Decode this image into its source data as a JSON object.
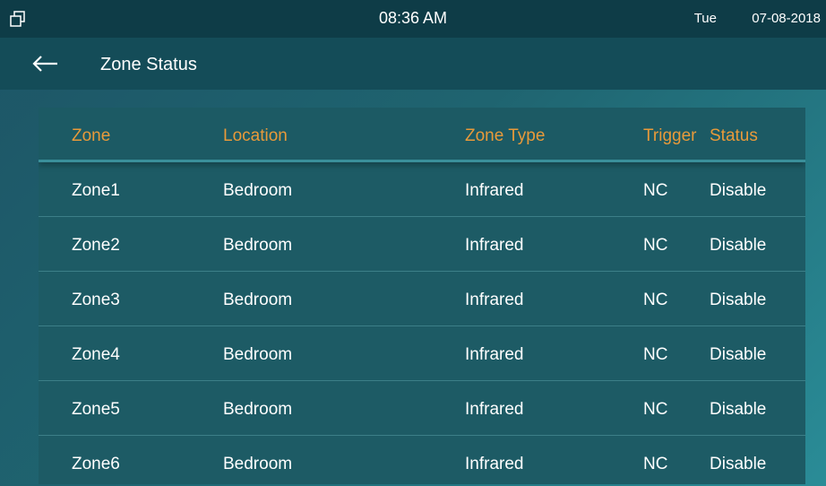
{
  "statusbar": {
    "time": "08:36 AM",
    "day": "Tue",
    "date": "07-08-2018"
  },
  "titlebar": {
    "title": "Zone Status"
  },
  "table": {
    "headers": [
      "Zone",
      "Location",
      "Zone Type",
      "Trigger",
      "Status"
    ],
    "rows": [
      [
        "Zone1",
        "Bedroom",
        "Infrared",
        "NC",
        "Disable"
      ],
      [
        "Zone2",
        "Bedroom",
        "Infrared",
        "NC",
        "Disable"
      ],
      [
        "Zone3",
        "Bedroom",
        "Infrared",
        "NC",
        "Disable"
      ],
      [
        "Zone4",
        "Bedroom",
        "Infrared",
        "NC",
        "Disable"
      ],
      [
        "Zone5",
        "Bedroom",
        "Infrared",
        "NC",
        "Disable"
      ],
      [
        "Zone6",
        "Bedroom",
        "Infrared",
        "NC",
        "Disable"
      ]
    ]
  },
  "colors": {
    "header_text": "#e89a3a",
    "statusbar_bg": "#0e3c47",
    "titlebar_bg": "#144c58",
    "panel_bg": "#1d5b65"
  },
  "icons": {
    "statusbar_left": "window-restore-icon",
    "back": "back-arrow-icon"
  }
}
